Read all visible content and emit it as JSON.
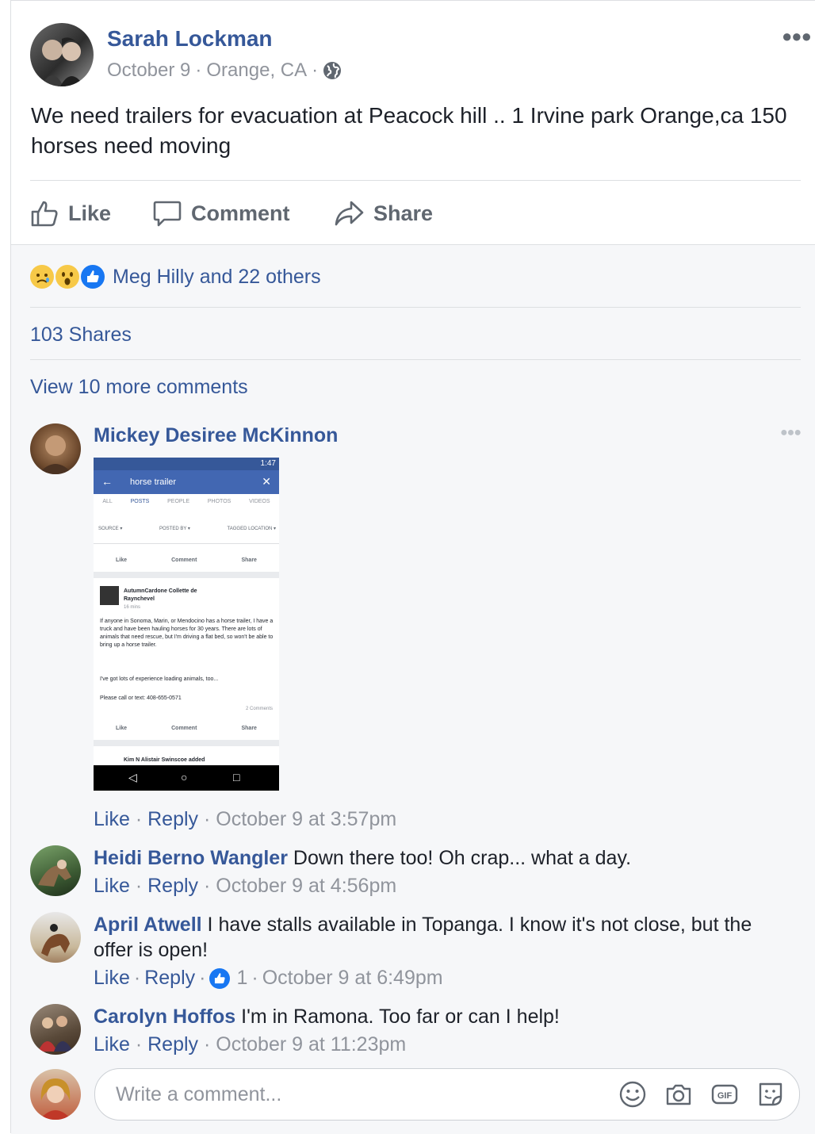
{
  "post": {
    "author": "Sarah Lockman",
    "date": "October 9",
    "separator": "·",
    "location": "Orange, CA",
    "text": "We need trailers for evacuation at Peacock hill .. 1 Irvine park Orange,ca 150 horses need moving",
    "actions": {
      "like": "Like",
      "comment": "Comment",
      "share": "Share"
    },
    "reactions_text": "Meg Hilly and 22 others",
    "shares": "103 Shares",
    "view_more": "View 10 more comments"
  },
  "comments": [
    {
      "author": "Mickey Desiree McKinnon",
      "text": "",
      "like": "Like",
      "reply": "Reply",
      "time": "October 9 at 3:57pm",
      "screenshot": {
        "status_time": "1:47",
        "search": "horse trailer",
        "tabs": [
          "ALL",
          "POSTS",
          "PEOPLE",
          "PHOTOS",
          "VIDEOS"
        ],
        "filters": [
          "SOURCE ▾",
          "POSTED BY ▾",
          "TAGGED LOCATION ▾"
        ],
        "actions": [
          "Like",
          "Comment",
          "Share"
        ],
        "post_author": "AutumnCardone Collette de Raynchevel",
        "post_time": "16 mins",
        "post_text": "If anyone in Sonoma, Marin, or Mendocino has a horse trailer, I have a truck and have been hauling horses for 30 years. There are lots of animals that need rescue, but I'm driving a flat bed, so won't be able to bring up a horse trailer.",
        "post_text2": "I've got lots of experience loading animals, too...",
        "post_text3": "Please call or text: 408-655-0571",
        "comments_count": "2 Comments",
        "next_author": "Kim N Alistair Swinscoe added"
      }
    },
    {
      "author": "Heidi Berno Wangler",
      "text": "Down there too! Oh crap... what a day.",
      "like": "Like",
      "reply": "Reply",
      "time": "October 9 at 4:56pm"
    },
    {
      "author": "April Atwell",
      "text": "I have stalls available in Topanga. I know it's not close, but the offer is open!",
      "like": "Like",
      "reply": "Reply",
      "reaction_count": "1",
      "time": "October 9 at 6:49pm"
    },
    {
      "author": "Carolyn Hoffos",
      "text": "I'm in Ramona. Too far or can I help!",
      "like": "Like",
      "reply": "Reply",
      "time": "October 9 at 11:23pm"
    }
  ],
  "write_comment": {
    "placeholder": "Write a comment..."
  },
  "colors": {
    "link": "#365899",
    "meta": "#90949c",
    "action": "#606770",
    "like_blue": "#1877f2"
  }
}
